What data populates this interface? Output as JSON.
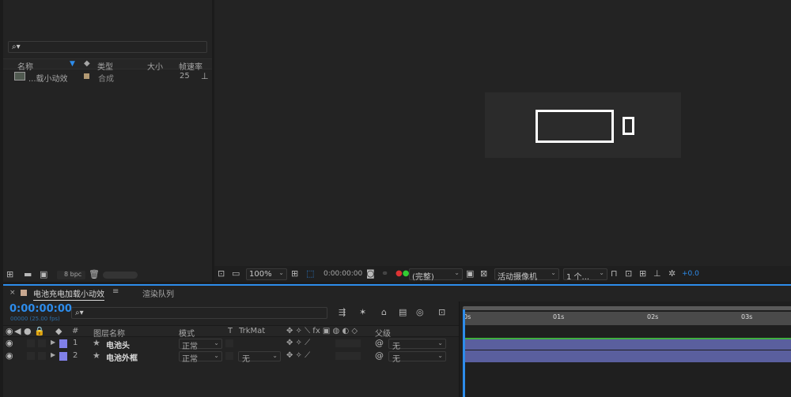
{
  "project": {
    "search_placeholder": "⌕▾",
    "columns": {
      "name": "名称",
      "type": "类型",
      "size": "大小",
      "fps": "帧速率"
    },
    "items": [
      {
        "name": "...载小动效",
        "type": "合成",
        "fps": "25"
      }
    ],
    "bpc": "8 bpc"
  },
  "viewer": {
    "zoom": "100%",
    "timecode": "0:00:00:00",
    "resolution": "(完整)",
    "camera": "活动摄像机",
    "views": "1 个...",
    "exposure": "+0.0"
  },
  "timeline": {
    "tabs": [
      {
        "label": "电池充电加载小动效"
      },
      {
        "label": "渲染队列"
      }
    ],
    "timecode": "0:00:00:00",
    "fps_info": "00000 (25.00 fps)",
    "search_placeholder": "⌕▾",
    "headers": {
      "num": "#",
      "layer_name": "图层名称",
      "mode": "模式",
      "t": "T",
      "trkmat": "TrkMat",
      "parent": "父级"
    },
    "layers": [
      {
        "num": "1",
        "name": "电池头",
        "mode": "正常",
        "trkmat": "",
        "parent": "无",
        "label_color": "#8080e8"
      },
      {
        "num": "2",
        "name": "电池外框",
        "mode": "正常",
        "trkmat": "无",
        "parent": "无",
        "label_color": "#8080e8"
      }
    ],
    "ruler": [
      "0s",
      "01s",
      "02s",
      "03s"
    ],
    "bar_color": "#5a5f9e",
    "accent": "#2d8ceb"
  }
}
